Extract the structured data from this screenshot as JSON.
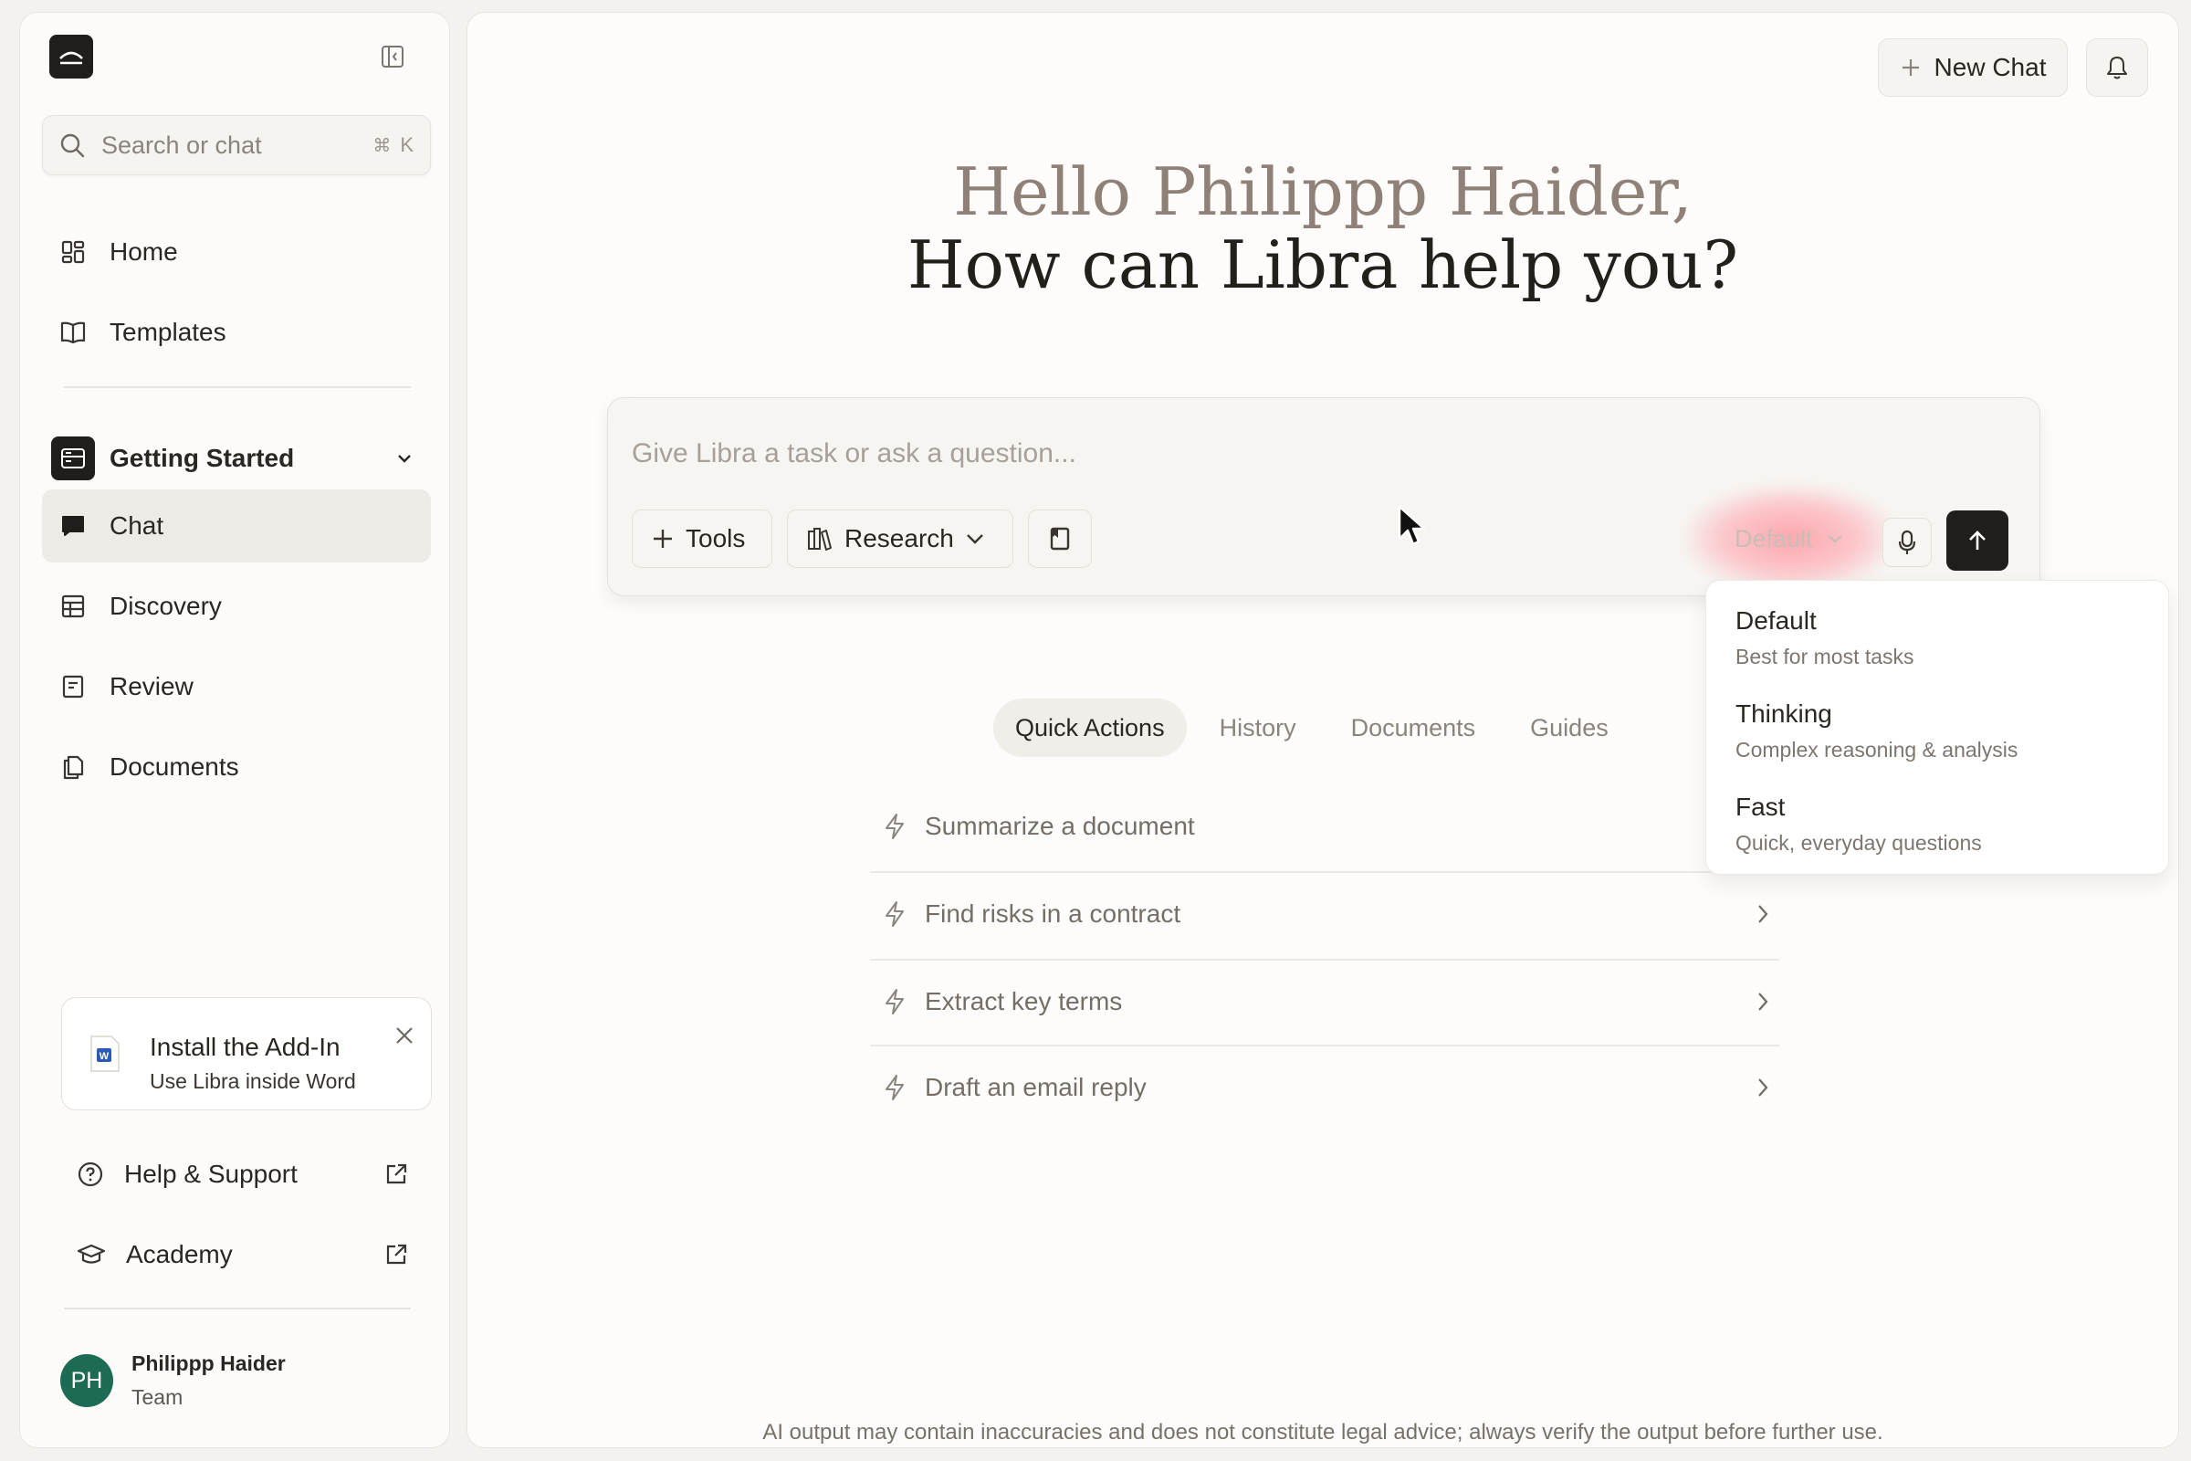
{
  "sidebar": {
    "search": {
      "placeholder": "Search or chat",
      "shortcut_mod": "⌘",
      "shortcut_key": "K"
    },
    "nav_top": [
      {
        "label": "Home",
        "icon": "grid-icon"
      },
      {
        "label": "Templates",
        "icon": "book-icon"
      }
    ],
    "project": {
      "label": "Getting Started",
      "icon": "server-icon"
    },
    "nav_project": [
      {
        "label": "Chat",
        "icon": "chat-bubble-icon",
        "active": true
      },
      {
        "label": "Discovery",
        "icon": "table-icon"
      },
      {
        "label": "Review",
        "icon": "review-doc-icon"
      },
      {
        "label": "Documents",
        "icon": "files-icon"
      }
    ],
    "addin": {
      "title": "Install the Add-In",
      "subtitle": "Use Libra inside Word",
      "word_letter": "W"
    },
    "links": [
      {
        "label": "Help & Support",
        "icon": "help-circle-icon"
      },
      {
        "label": "Academy",
        "icon": "graduation-cap-icon"
      }
    ],
    "user": {
      "initials": "PH",
      "name": "Philippp Haider",
      "role": "Team",
      "avatar_color": "#1d6b54"
    }
  },
  "header": {
    "new_chat_label": "New Chat"
  },
  "greeting": {
    "line1": "Hello Philippp Haider,",
    "line2": "How can Libra help you?"
  },
  "composer": {
    "placeholder": "Give Libra a task or ask a question...",
    "tools_label": "Tools",
    "research_label": "Research",
    "model_label": "Default"
  },
  "model_menu": [
    {
      "title": "Default",
      "desc": "Best for most tasks"
    },
    {
      "title": "Thinking",
      "desc": "Complex reasoning & analysis"
    },
    {
      "title": "Fast",
      "desc": "Quick, everyday questions"
    }
  ],
  "tabs": [
    {
      "label": "Quick Actions",
      "active": true
    },
    {
      "label": "History"
    },
    {
      "label": "Documents"
    },
    {
      "label": "Guides"
    }
  ],
  "quick_actions": [
    {
      "label": "Summarize a document"
    },
    {
      "label": "Find risks in a contract"
    },
    {
      "label": "Extract key terms"
    },
    {
      "label": "Draft an email reply"
    }
  ],
  "disclaimer": "AI output may contain inaccuracies and does not constitute legal advice; always verify the output before further use.",
  "colors": {
    "accent_dark": "#211d1a",
    "avatar": "#1d6b54",
    "highlight": "#ff8c96"
  }
}
